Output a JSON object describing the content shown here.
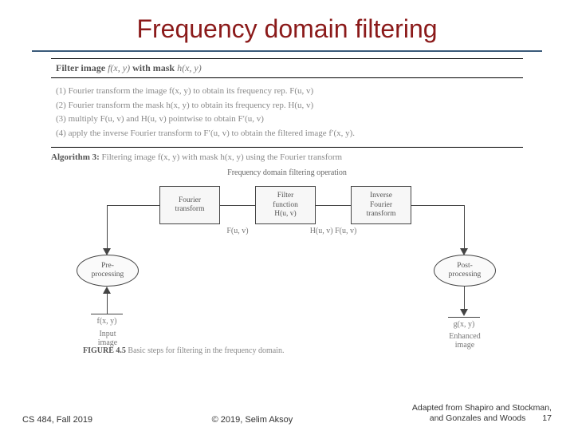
{
  "title": "Frequency domain filtering",
  "algo": {
    "head_prefix": "Filter image ",
    "head_f": "f(x, y)",
    "head_mid": " with mask ",
    "head_h": "h(x, y)",
    "step1": "(1) Fourier transform the image f(x, y) to obtain its frequency rep. F(u, v)",
    "step2": "(2) Fourier transform the mask h(x, y) to obtain its frequency rep. H(u, v)",
    "step3": "(3) multiply F(u, v) and H(u, v) pointwise to obtain F′(u, v)",
    "step4": "(4) apply the inverse Fourier transform to F′(u, v) to obtain the filtered image f′(x, y).",
    "caption_label": "Algorithm 3:",
    "caption_text": " Filtering image f(x, y) with mask h(x, y) using the Fourier transform"
  },
  "diagram": {
    "title": "Frequency domain filtering operation",
    "fourier": "Fourier\ntransform",
    "filter": "Filter\nfunction\nH(u, v)",
    "inverse": "Inverse\nFourier\ntransform",
    "pre": "Pre-\nprocessing",
    "post": "Post-\nprocessing",
    "Fuv": "F(u, v)",
    "HFuv": "H(u, v) F(u, v)",
    "fxy": "f(x, y)",
    "gxy": "g(x, y)",
    "input": "Input\nimage",
    "output": "Enhanced\nimage",
    "figlabel": "FIGURE 4.5",
    "figtext": " Basic steps for filtering in the frequency domain."
  },
  "footer": {
    "left": "CS 484, Fall 2019",
    "center": "© 2019, Selim Aksoy",
    "attrib1": "Adapted from Shapiro and Stockman,",
    "attrib2": "and Gonzales and Woods",
    "slide": "17"
  }
}
